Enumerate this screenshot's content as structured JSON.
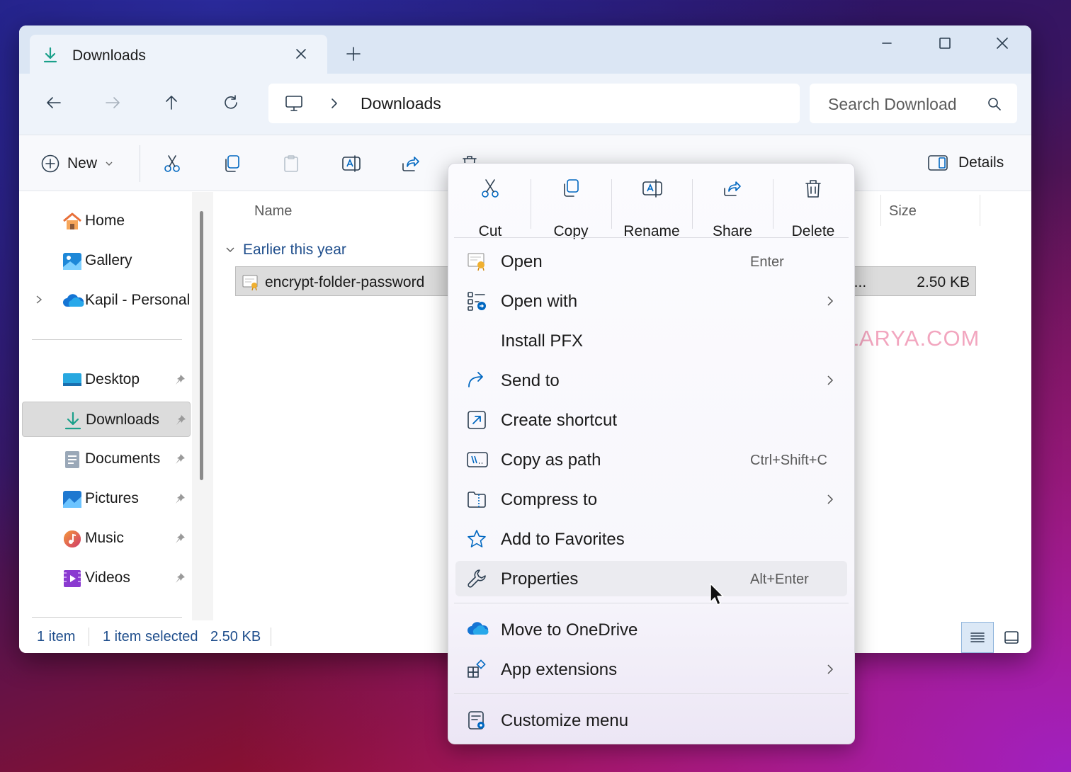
{
  "window": {
    "tab_title": "Downloads",
    "new_tab_symbol": "+"
  },
  "navigation": {
    "breadcrumb": [
      "Downloads"
    ],
    "search_placeholder": "Search Download"
  },
  "toolbar": {
    "new_label": "New",
    "details_label": "Details"
  },
  "sidebar": {
    "items": [
      {
        "label": "Home",
        "icon": "home-icon"
      },
      {
        "label": "Gallery",
        "icon": "gallery-icon"
      },
      {
        "label": "Kapil - Personal",
        "icon": "onedrive-cloud-icon"
      },
      {
        "label": "Desktop",
        "icon": "desktop-icon"
      },
      {
        "label": "Downloads",
        "icon": "download-icon"
      },
      {
        "label": "Documents",
        "icon": "documents-icon"
      },
      {
        "label": "Pictures",
        "icon": "pictures-icon"
      },
      {
        "label": "Music",
        "icon": "music-icon"
      },
      {
        "label": "Videos",
        "icon": "videos-icon"
      }
    ]
  },
  "content": {
    "columns": {
      "name": "Name",
      "size": "Size"
    },
    "group_label": "Earlier this year",
    "file": {
      "name": "encrypt-folder-password",
      "type_partial": "i...",
      "size": "2.50 KB"
    }
  },
  "status": {
    "count": "1 item",
    "selected": "1 item selected",
    "selected_size": "2.50 KB"
  },
  "context_menu": {
    "quick_actions": [
      {
        "label": "Cut",
        "icon": "scissors-icon"
      },
      {
        "label": "Copy",
        "icon": "copy-icon"
      },
      {
        "label": "Rename",
        "icon": "rename-icon"
      },
      {
        "label": "Share",
        "icon": "share-icon"
      },
      {
        "label": "Delete",
        "icon": "trash-icon"
      }
    ],
    "items": [
      {
        "label": "Open",
        "accelerator": "Enter"
      },
      {
        "label": "Open with"
      },
      {
        "label": "Install PFX"
      },
      {
        "label": "Send to"
      },
      {
        "label": "Create shortcut"
      },
      {
        "label": "Copy as path",
        "accelerator": "Ctrl+Shift+C"
      },
      {
        "label": "Compress to"
      },
      {
        "label": "Add to Favorites"
      },
      {
        "label": "Properties",
        "accelerator": "Alt+Enter"
      },
      {
        "label": "Move to OneDrive"
      },
      {
        "label": "App extensions"
      },
      {
        "label": "Customize menu"
      }
    ]
  },
  "watermark": "KAPILARYA.COM",
  "colors": {
    "accent": "#0067c0",
    "link_text": "#1f4e8c",
    "watermark": "#f2a6bf"
  }
}
